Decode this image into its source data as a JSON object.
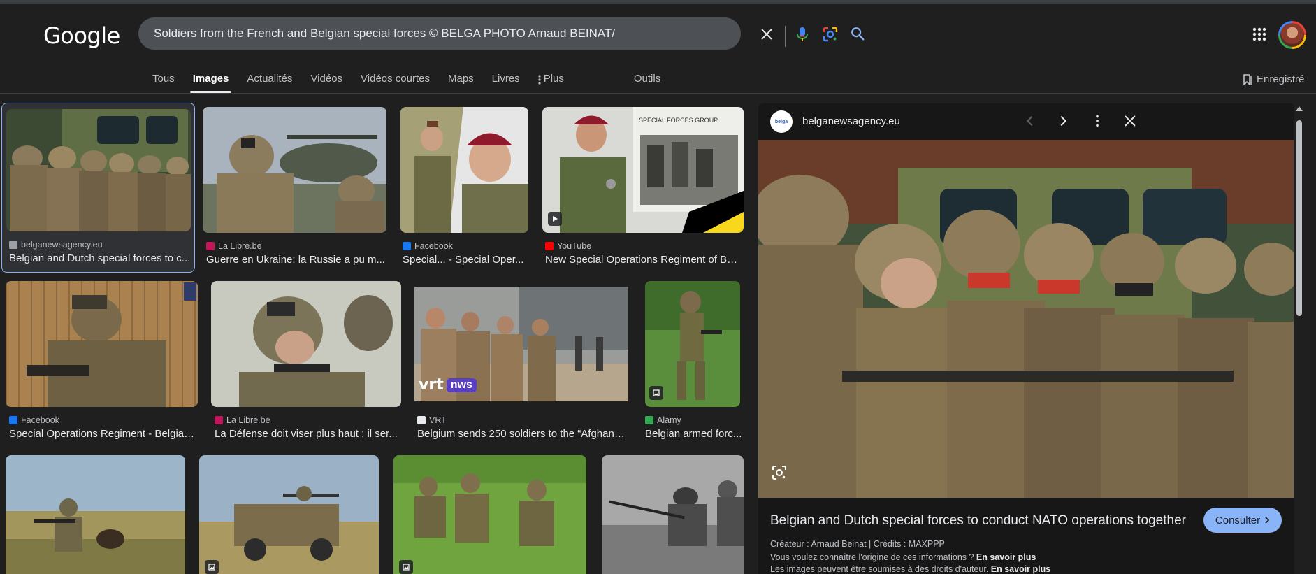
{
  "logo": "Google",
  "search": {
    "query": "Soldiers from the French and Belgian special forces © BELGA PHOTO Arnaud BEINAT/MAXPPP"
  },
  "tabs": [
    {
      "label": "Tous"
    },
    {
      "label": "Images"
    },
    {
      "label": "Actualités"
    },
    {
      "label": "Vidéos"
    },
    {
      "label": "Vidéos courtes"
    },
    {
      "label": "Maps"
    },
    {
      "label": "Livres"
    },
    {
      "label": "Plus"
    },
    {
      "label": "Outils"
    }
  ],
  "saved_label": "Enregistré",
  "results": [
    {
      "source": "belganewsagency.eu",
      "title": "Belgian and Dutch special forces to c...",
      "favicon_color": "#9aa0a6"
    },
    {
      "source": "La Libre.be",
      "title": "Guerre en Ukraine: la Russie a pu m...",
      "favicon_color": "#c2185b"
    },
    {
      "source": "Facebook",
      "title": "Special... - Special Oper...",
      "favicon_color": "#1877f2"
    },
    {
      "source": "YouTube",
      "title": "New Special Operations Regiment of Bel...",
      "favicon_color": "#ff0000"
    },
    {
      "source": "Facebook",
      "title": "Special Operations Regiment - Belgian ...",
      "favicon_color": "#1877f2"
    },
    {
      "source": "La Libre.be",
      "title": "La Défense doit viser plus haut : il ser...",
      "favicon_color": "#c2185b"
    },
    {
      "source": "VRT",
      "title": "Belgium sends 250 soldiers to the “Afghanis...",
      "favicon_color": "#e8eaed"
    },
    {
      "source": "Alamy",
      "title": "Belgian armed forc...",
      "favicon_color": "#34a853"
    }
  ],
  "thumb_overlays": {
    "vrt": "vrt",
    "nws": "nws",
    "special_forces_banner": "SPECIAL FORCES GROUP"
  },
  "panel": {
    "site": "belganewsagency.eu",
    "favicon_text": "belga",
    "title": "Belgian and Dutch special forces to conduct NATO operations together",
    "button": "Consulter",
    "credit": "Créateur : Arnaud Beinat | Crédits : MAXPPP",
    "info_text": "Vous voulez connaître l'origine de ces informations ? ",
    "info_link": "En savoir plus",
    "rights_text": "Les images peuvent être soumises à des droits d'auteur. ",
    "rights_link": "En savoir plus"
  }
}
